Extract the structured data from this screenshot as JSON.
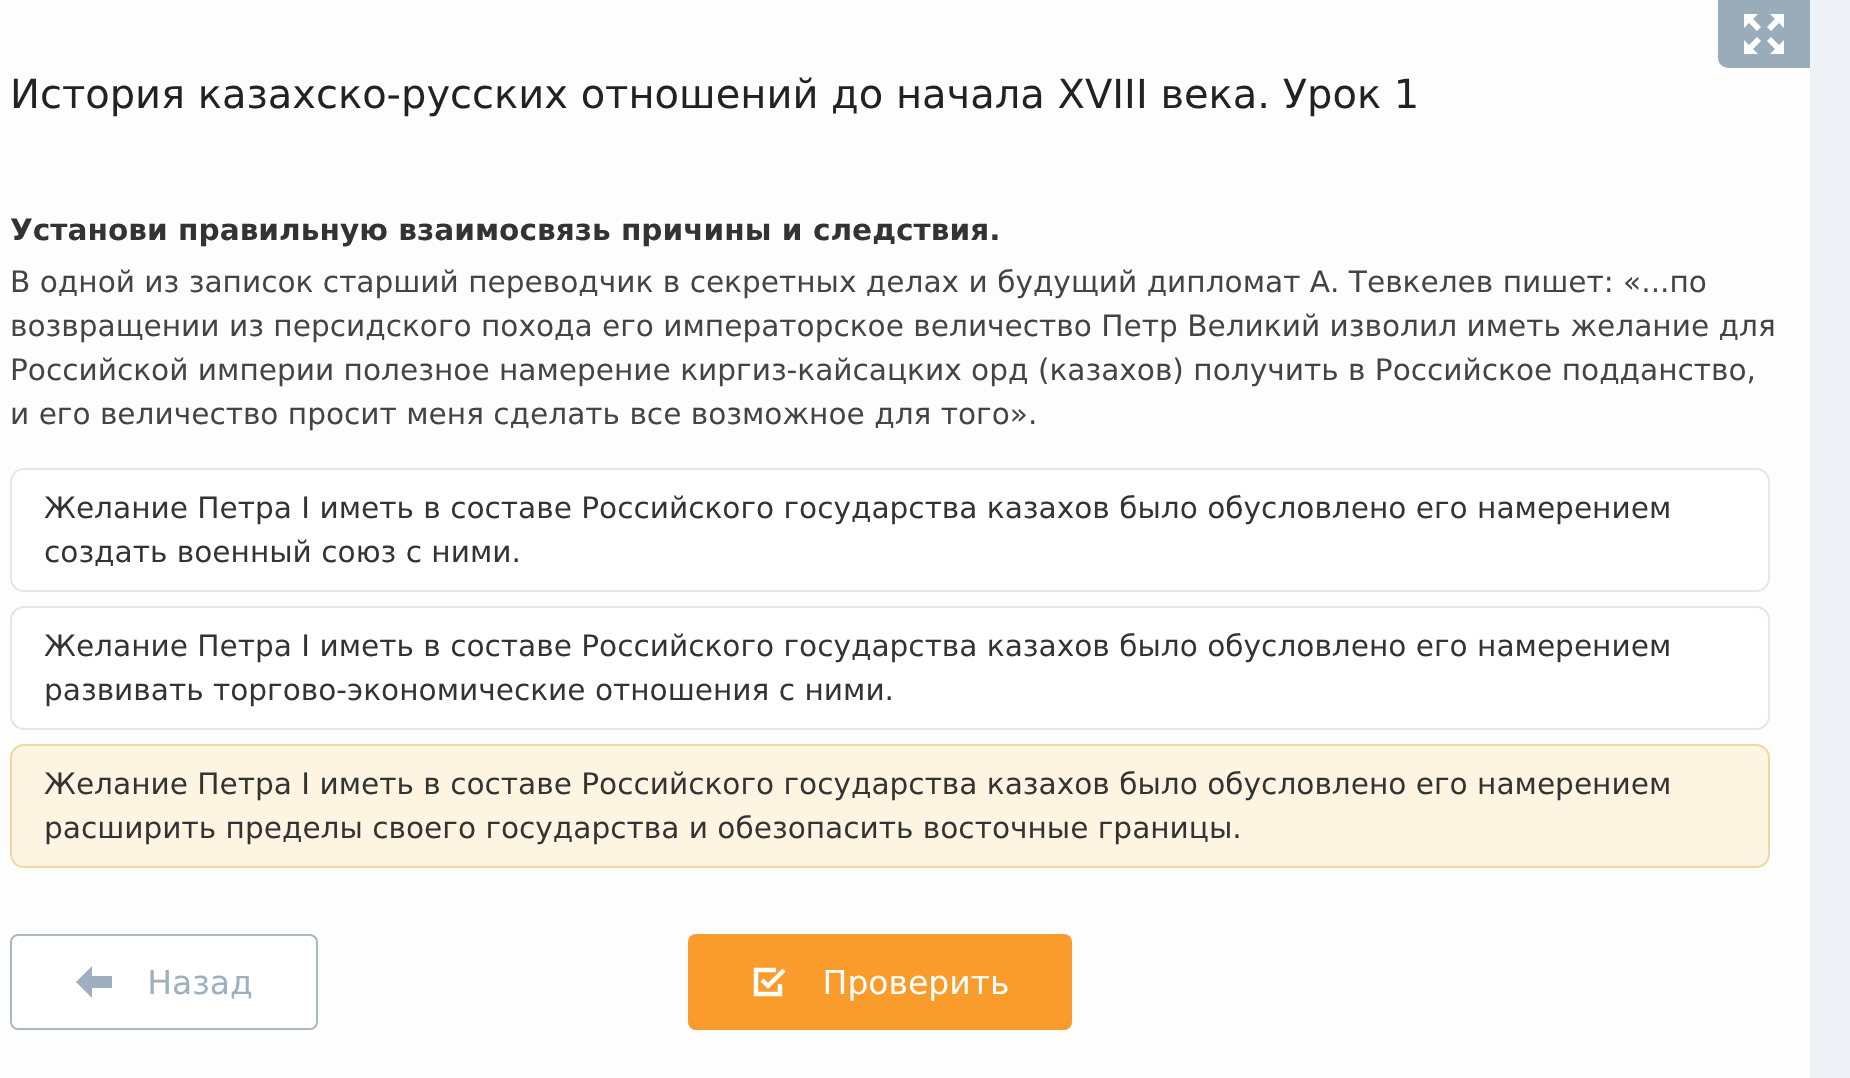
{
  "title": "История казахско-русских отношений до начала XVIII века. Урок 1",
  "instruction": "Установи правильную взаимосвязь причины и следствия.",
  "text": "В одной из записок старший переводчик в секретных делах и будущий дипломат А. Тевкелев пишет: «...по возвращении из персидского похода его императорское величество Петр Великий изволил иметь желание для Российской империи полезное намерение киргиз-кайсацких орд (казахов) получить в Российское подданство, и его величество просит меня сделать все возможное для того».",
  "options": [
    {
      "text": "Желание Петра I иметь в составе Российского государства казахов было обусловлено его намерением создать военный союз с ними.",
      "selected": false
    },
    {
      "text": "Желание Петра I иметь в составе Российского государства казахов было обусловлено его намерением развивать торгово-экономические отношения с ними.",
      "selected": false
    },
    {
      "text": "Желание Петра I иметь в составе Российского государства казахов было обусловлено его намерением расширить пределы своего государства и обезопасить восточные границы.",
      "selected": true
    }
  ],
  "buttons": {
    "back": "Назад",
    "check": "Проверить"
  }
}
